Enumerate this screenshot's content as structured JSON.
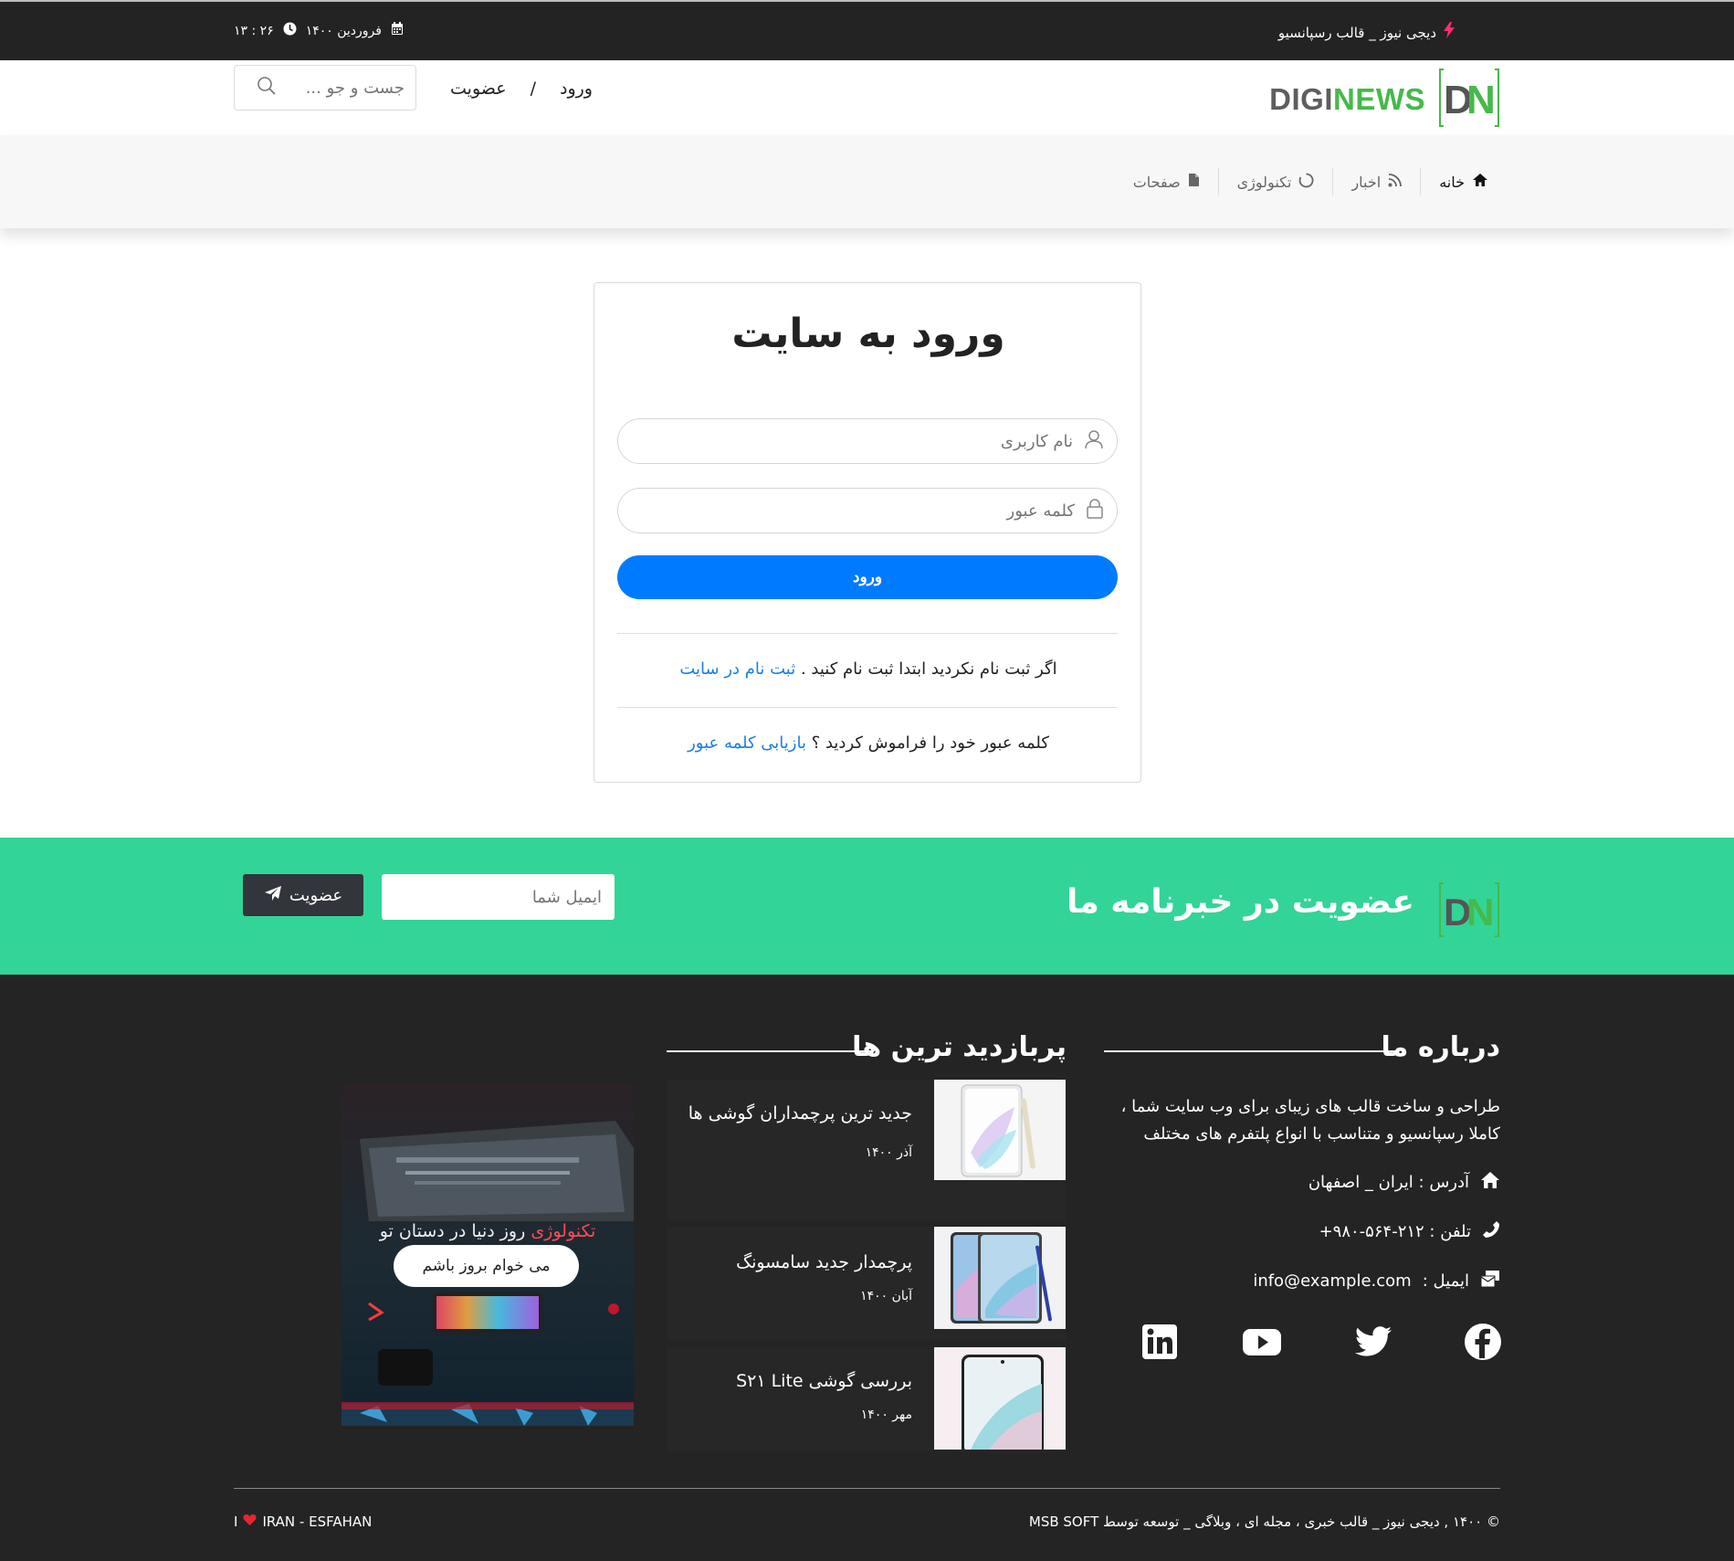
{
  "topbar": {
    "tagline": "دیجی نیوز _ قالب رسپانسیو",
    "date": "فروردین ۱۴۰۰",
    "time": "۲۶ : ۱۳"
  },
  "header": {
    "logo_digi": "DIGI",
    "logo_news": "NEWS",
    "login_link": "ورود",
    "separator": "/",
    "register_link": "عضویت",
    "search_placeholder": "جست و جو ..."
  },
  "nav": {
    "items": [
      {
        "label": "خانه",
        "icon": "home-icon"
      },
      {
        "label": "اخبار",
        "icon": "rss-icon"
      },
      {
        "label": "تکنولوژی",
        "icon": "circle-notch-icon"
      },
      {
        "label": "صفحات",
        "icon": "file-icon"
      }
    ]
  },
  "login": {
    "title": "ورود به سایت",
    "username_placeholder": "نام کاربری",
    "password_placeholder": "کلمه عبور",
    "submit_label": "ورود",
    "register_prompt": "اگر ثبت نام نکردید ابتدا ثبت نام کنید .",
    "register_link": "ثبت نام در سایت",
    "forgot_prompt": "کلمه عبور خود را فراموش کردید ؟",
    "forgot_link": "بازیابی کلمه عبور"
  },
  "newsletter": {
    "title": "عضویت در خبرنامه ما",
    "email_placeholder": "ایمیل شما",
    "button_label": "عضویت"
  },
  "footer": {
    "about": {
      "title": "درباره ما",
      "text": "طراحی و ساخت قالب های زیبای برای وب سایت شما ، کاملا رسپانسیو و متناسب با انواع پلتفرم های مختلف",
      "address": "آدرس : ایران _ اصفهان",
      "phone": "تلفن : ۲۱۲-۵۶۴-۹۸۰+",
      "email_label": "ایمیل :",
      "email": "info@example.com"
    },
    "popular": {
      "title": "پربازدید ترین ها",
      "posts": [
        {
          "title": "جدید ترین پرچمداران گوشی ها",
          "date": "آذر ۱۴۰۰"
        },
        {
          "title": "پرچمدار جدید سامسونگ",
          "date": "آبان ۱۴۰۰"
        },
        {
          "title": "بررسی گوشی S۲۱ Lite",
          "date": "مهر ۱۴۰۰"
        }
      ]
    },
    "promo": {
      "highlight": "تکنولوژی",
      "text": "روز دنیا در دستان تو",
      "button": "می خوام بروز باشم"
    },
    "copyright": "© ۱۴۰۰ , دیجی نیوز _ قالب خبری ، مجله ای ، وبلاگی _ توسعه توسط MSB SOFT",
    "location_prefix": "I",
    "location": "IRAN - ESFAHAN"
  },
  "colors": {
    "topbar": "#232323",
    "accent_green": "#33d497",
    "primary_blue": "#007bff",
    "link_blue": "#1a7ee8",
    "footer_bg": "#242424",
    "logo_green": "#46b94a"
  }
}
